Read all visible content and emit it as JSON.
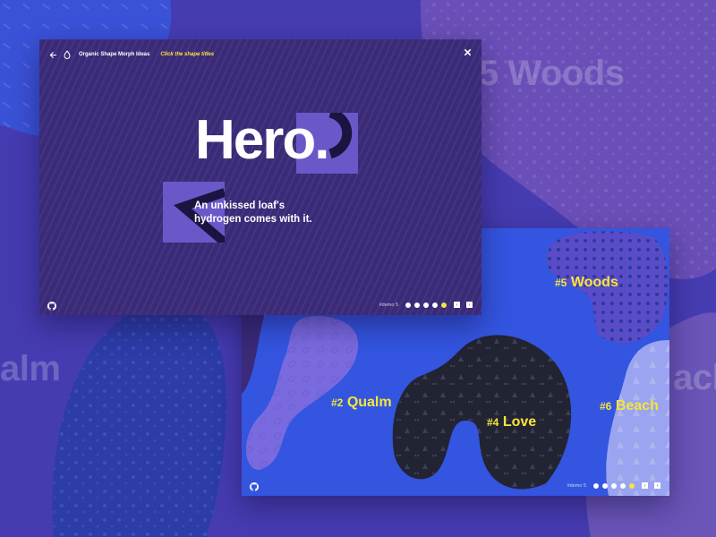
{
  "background": {
    "labels": [
      "5 Woods",
      "alm",
      "ach"
    ]
  },
  "main_window": {
    "app_title": "Organic Shape Morph Ideas",
    "hint": "Click the shape titles",
    "hero": "Hero.",
    "tagline": "An unkissed loaf's hydrogen comes with it.",
    "demo_label": "#demo 5",
    "icons": [
      "back-arrow-icon",
      "drop-icon",
      "close-icon",
      "github-icon"
    ]
  },
  "second_window": {
    "demo_label": "#demo 5",
    "shape_titles": [
      {
        "hash": "#5",
        "name": "Woods"
      },
      {
        "hash": "#2",
        "name": "Qualm"
      },
      {
        "hash": "#4",
        "name": "Love"
      },
      {
        "hash": "#6",
        "name": "Beach"
      }
    ]
  },
  "pagination": {
    "count": 5,
    "active_index": 4
  },
  "colors": {
    "accent_yellow": "#f5e63a",
    "main_window_bg": "#3a2a78",
    "second_window_bg": "#3355e0",
    "square_purple": "#6a58c8"
  }
}
